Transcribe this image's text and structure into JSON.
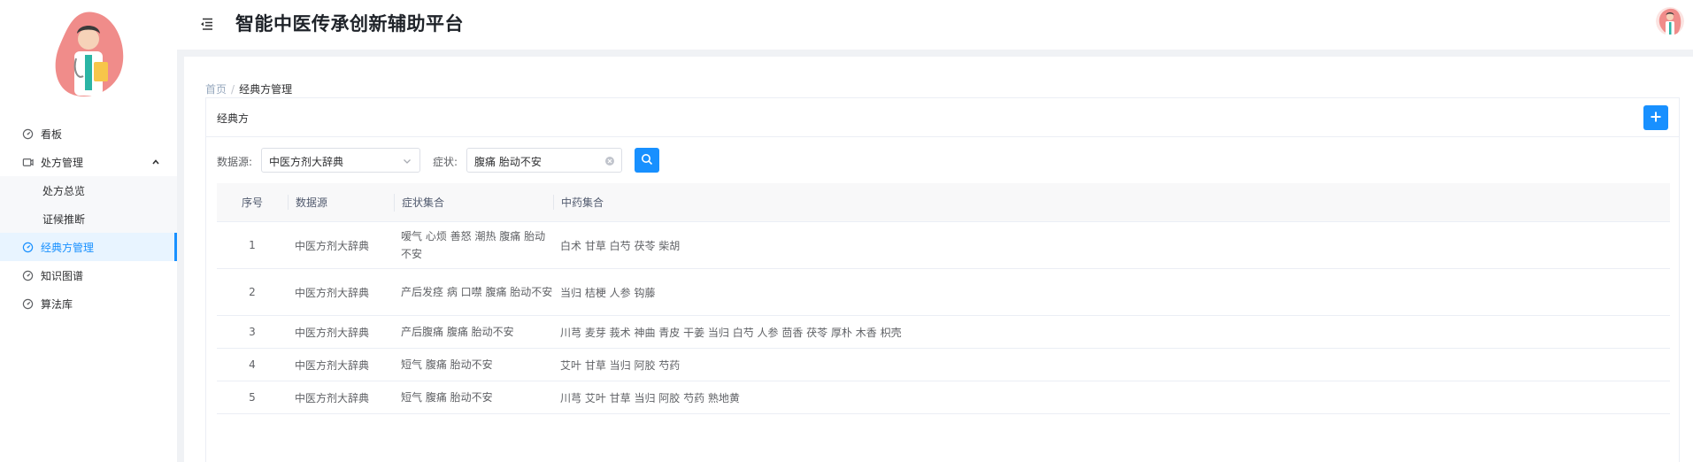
{
  "header": {
    "title": "智能中医传承创新辅助平台"
  },
  "sidebar": {
    "items": [
      {
        "label": "看板",
        "icon": "dashboard-icon"
      },
      {
        "label": "处方管理",
        "icon": "prescription-icon"
      },
      {
        "label": "处方总览"
      },
      {
        "label": "证候推断"
      },
      {
        "label": "经典方管理",
        "icon": "dashboard-icon"
      },
      {
        "label": "知识图谱",
        "icon": "dashboard-icon"
      },
      {
        "label": "算法库",
        "icon": "dashboard-icon"
      }
    ]
  },
  "breadcrumb": {
    "home": "首页",
    "sep": "/",
    "current": "经典方管理"
  },
  "card": {
    "title": "经典方"
  },
  "filters": {
    "source_label": "数据源:",
    "source_value": "中医方剂大辞典",
    "symptom_label": "症状:",
    "symptom_value": "腹痛 胎动不安"
  },
  "table": {
    "headers": [
      "序号",
      "数据源",
      "症状集合",
      "中药集合"
    ],
    "rows": [
      {
        "index": "1",
        "source": "中医方剂大辞典",
        "symptoms": "嗳气 心烦 善怒 潮热 腹痛 胎动不安",
        "herbs": "白术 甘草 白芍 茯苓 柴胡"
      },
      {
        "index": "2",
        "source": "中医方剂大辞典",
        "symptoms": "产后发痉 病 口噤 腹痛 胎动不安",
        "herbs": "当归 桔梗 人参 钩藤"
      },
      {
        "index": "3",
        "source": "中医方剂大辞典",
        "symptoms": "产后腹痛 腹痛 胎动不安",
        "herbs": "川芎 麦芽 莪术 神曲 青皮 干姜 当归 白芍 人参 茴香 茯苓 厚朴 木香 枳壳"
      },
      {
        "index": "4",
        "source": "中医方剂大辞典",
        "symptoms": "短气 腹痛 胎动不安",
        "herbs": "艾叶 甘草 当归 阿胶 芍药"
      },
      {
        "index": "5",
        "source": "中医方剂大辞典",
        "symptoms": "短气 腹痛 胎动不安",
        "herbs": "川芎 艾叶 甘草 当归 阿胶 芍药 熟地黄"
      }
    ]
  },
  "colors": {
    "primary": "#1890ff",
    "active_bg": "#e8f4ff"
  }
}
